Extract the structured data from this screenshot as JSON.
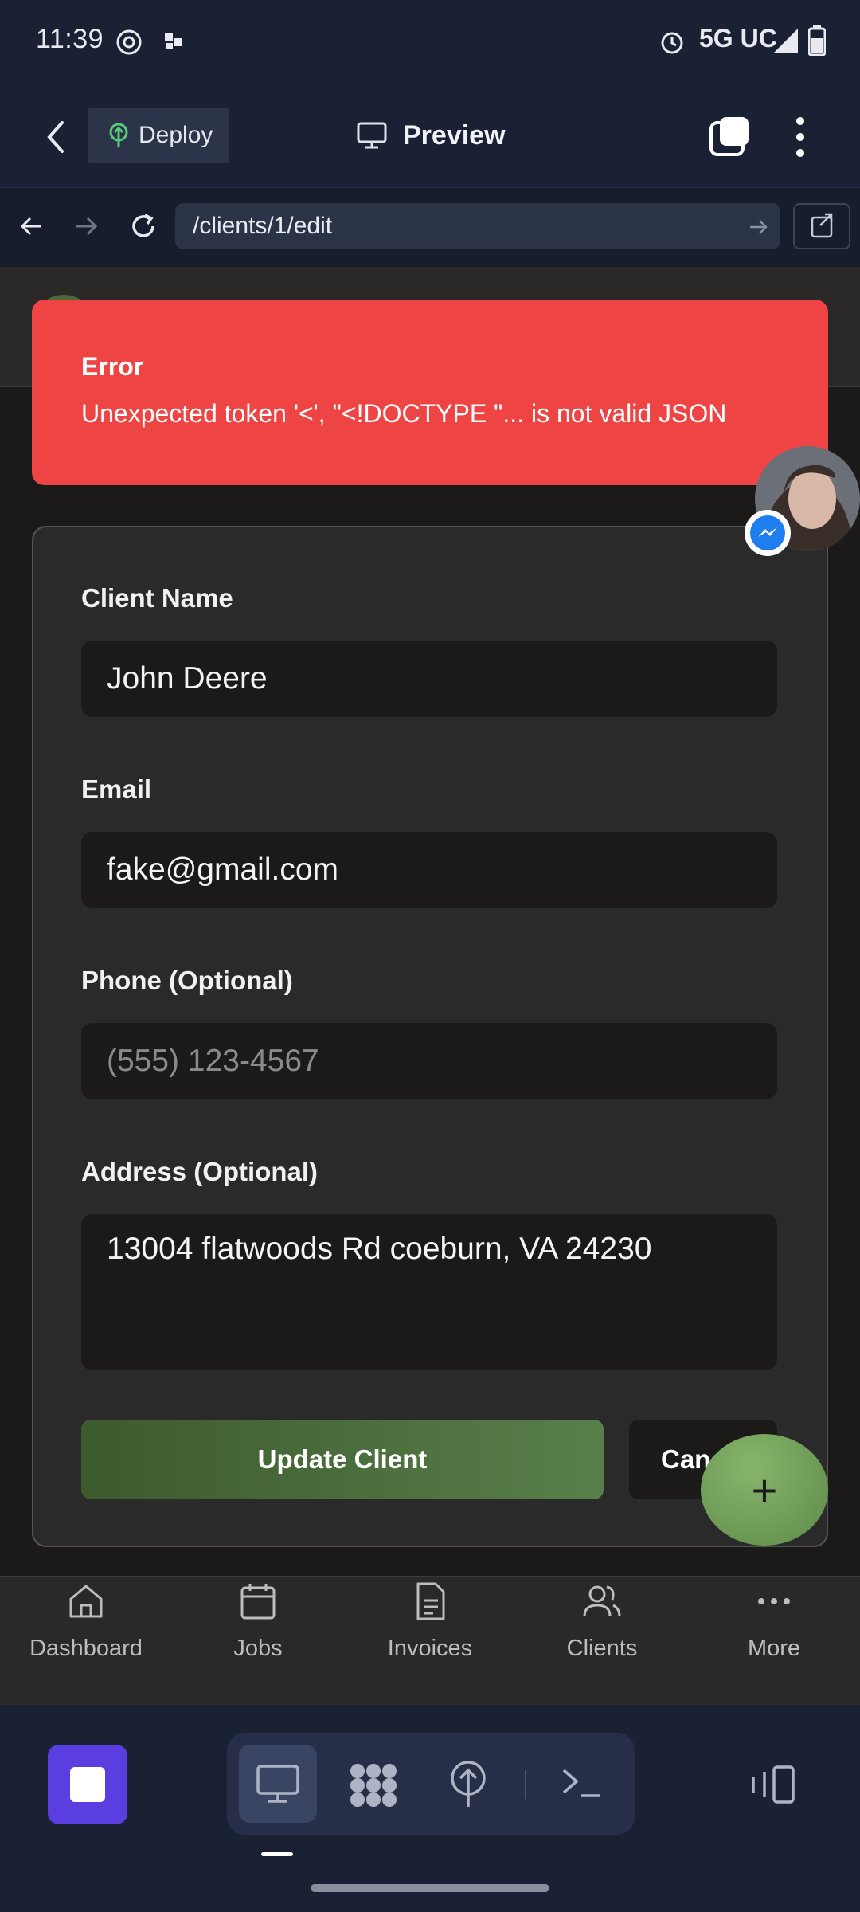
{
  "status_bar": {
    "time": "11:39",
    "network": "5G UC"
  },
  "header": {
    "deploy_label": "Deploy",
    "title": "Preview"
  },
  "browser": {
    "url": "/clients/1/edit"
  },
  "error": {
    "title": "Error",
    "message": "Unexpected token '<', \"<!DOCTYPE \"... is not valid JSON"
  },
  "form": {
    "client_name_label": "Client Name",
    "client_name_value": "John Deere",
    "email_label": "Email",
    "email_value": "fake@gmail.com",
    "phone_label": "Phone (Optional)",
    "phone_placeholder": "(555) 123-4567",
    "address_label": "Address (Optional)",
    "address_value": "13004 flatwoods Rd coeburn, VA 24230",
    "update_label": "Update Client",
    "cancel_label": "Canc"
  },
  "fab": {
    "icon": "plus-icon",
    "label": "+"
  },
  "nav": {
    "items": [
      {
        "label": "Dashboard",
        "icon": "home-icon"
      },
      {
        "label": "Jobs",
        "icon": "calendar-icon"
      },
      {
        "label": "Invoices",
        "icon": "document-icon"
      },
      {
        "label": "Clients",
        "icon": "users-icon"
      },
      {
        "label": "More",
        "icon": "more-icon"
      }
    ]
  },
  "colors": {
    "error": "#ef4444",
    "accent_green": "#587f4a",
    "device_accent": "#5a3ee0"
  }
}
